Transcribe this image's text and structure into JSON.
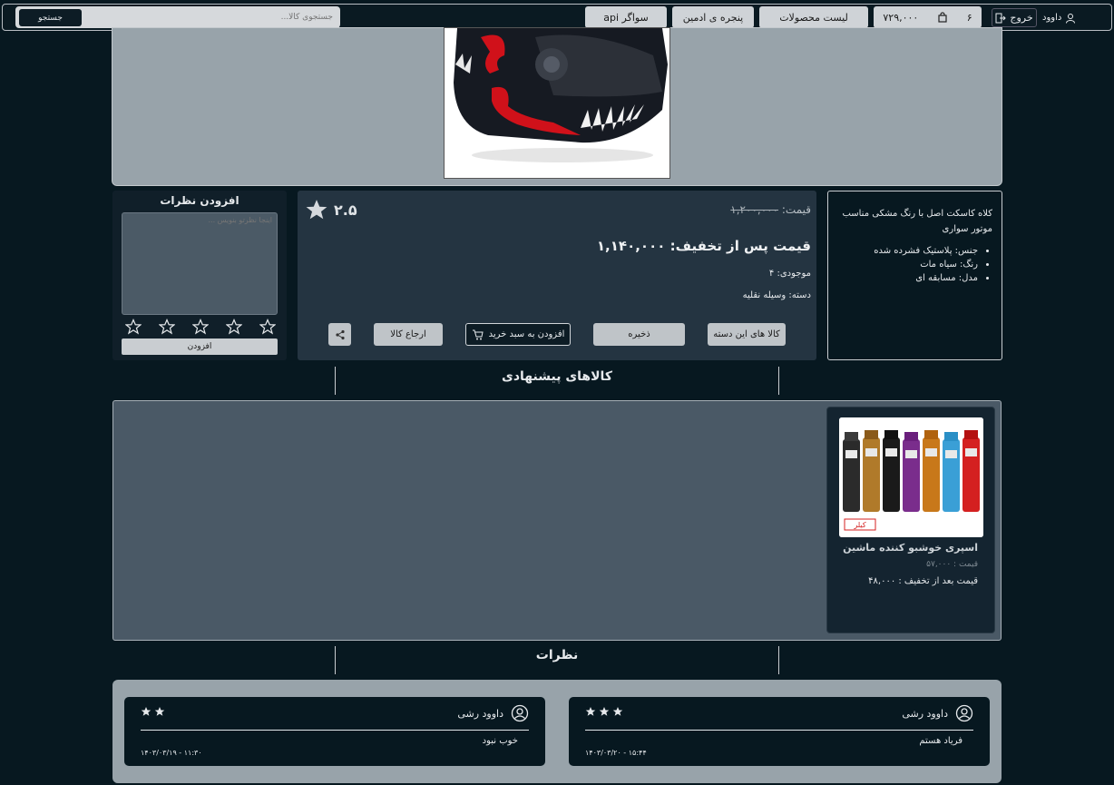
{
  "navbar": {
    "user_name": "داوود",
    "logout_label": "خروج",
    "cart_count": "۶",
    "wallet": "۷۲۹,۰۰۰",
    "products_list": "لیست محصولات",
    "admin_panel": "پنجره ی ادمین",
    "swagger": "سواگر api",
    "search_placeholder": "جستجوی کالا...",
    "search_label": "جستجو"
  },
  "product": {
    "description": "کلاه کاسکت اصل با رنگ مشکی مناسب موتور سواری",
    "features": [
      "جنس: پلاستیک فشرده شده",
      "رنگ: سیاه مات",
      "مدل: مسابقه ای"
    ],
    "price_label": "قیمت:",
    "price_old": "۱,۲۰۰,۰۰۰",
    "rating": "۲.۵",
    "discount_price": "قیمت پس از تخفیف: ۱,۱۴۰,۰۰۰",
    "stock": "موجودی: ۴",
    "category": "دسته: وسیله نقلیه",
    "btn_category_items": "کالا های این دسته",
    "btn_save": "ذخیره",
    "btn_add_cart": "افزودن به سبد خرید",
    "btn_return": "ارجاع کالا"
  },
  "review_form": {
    "title": "افزودن نظرات",
    "placeholder": "اینجا نظرتو بنویس ...",
    "submit": "افزودن"
  },
  "suggestions": {
    "title": "کالاهای پیشنهادی",
    "items": [
      {
        "title": "اسپری خوشبو کننده ماشین",
        "price_old": "قیمت : ۵۷,۰۰۰",
        "price_new": "قیمت بعد از تخفیف : ۴۸,۰۰۰",
        "brand_text": "کیلر"
      }
    ]
  },
  "comments": {
    "title": "نظرات",
    "items": [
      {
        "user": "داوود رشی",
        "stars": 3,
        "text": "فریاد هستم",
        "date": "۱۴۰۳/۰۳/۲۰ - ۱۵:۴۴"
      },
      {
        "user": "داوود رشی",
        "stars": 2,
        "text": "خوب نبود",
        "date": "۱۴۰۳/۰۳/۱۹ - ۱۱:۳۰"
      }
    ]
  },
  "colors": {
    "page_bg": "#071820",
    "panel_light": "#98a3aa",
    "panel_dark": "#243441",
    "suggest_bg": "#4a5966"
  }
}
